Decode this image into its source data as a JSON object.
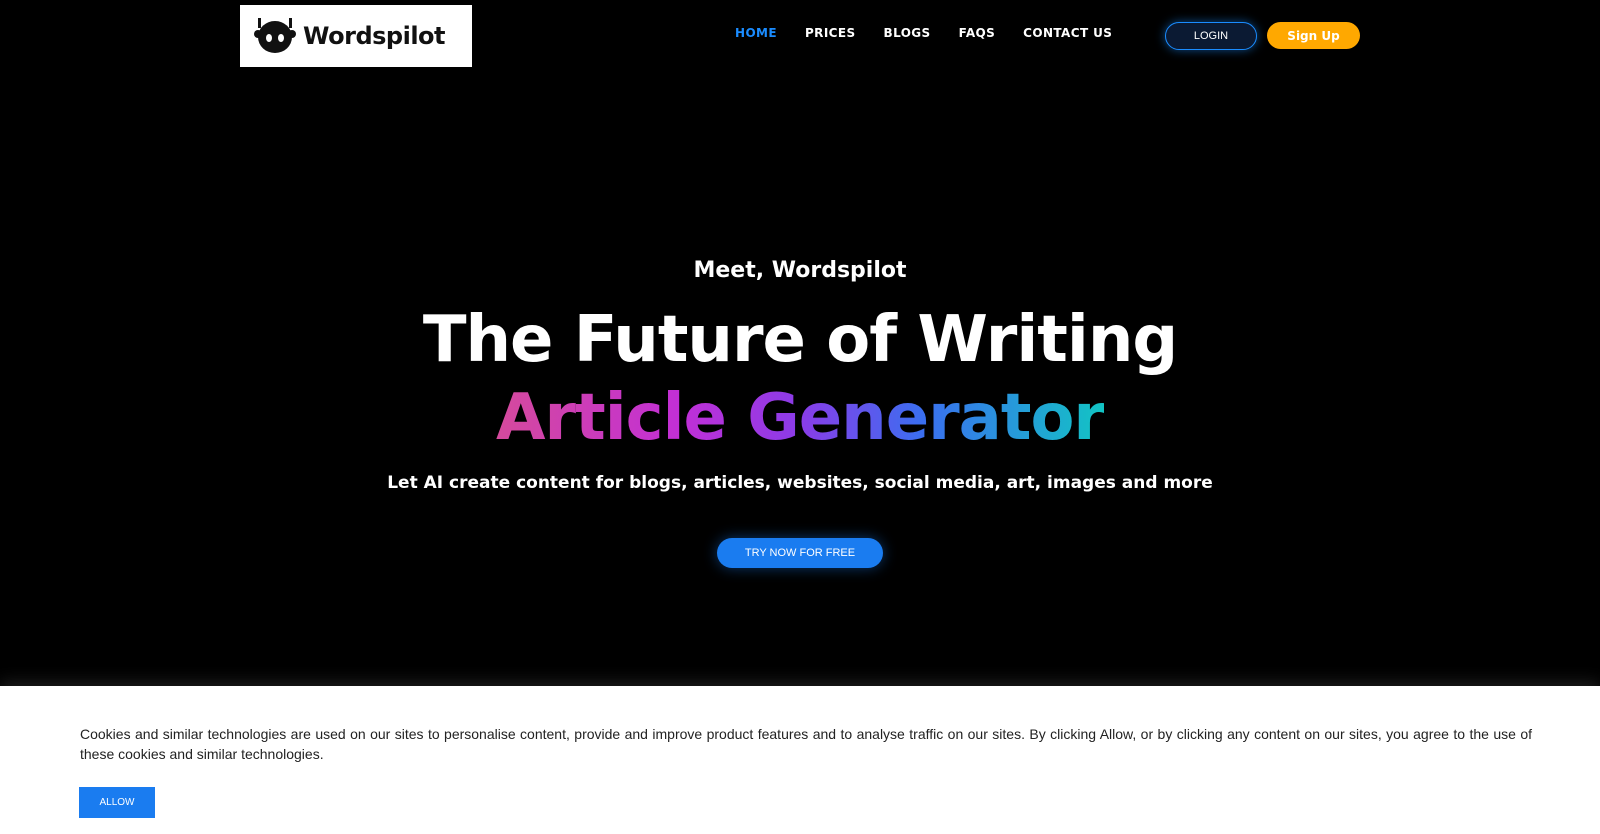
{
  "colors": {
    "accent": "#1a8cff",
    "signup": "#ffa800",
    "cta": "#1a7cf0",
    "background": "#000000"
  },
  "header": {
    "logo": {
      "text": "Wordspilot",
      "icon": "robot-head-icon"
    },
    "nav": [
      {
        "label": "HOME",
        "active": true
      },
      {
        "label": "PRICES",
        "active": false
      },
      {
        "label": "BLOGS",
        "active": false
      },
      {
        "label": "FAQS",
        "active": false
      },
      {
        "label": "CONTACT US",
        "active": false
      }
    ],
    "login_label": "LOGIN",
    "signup_label": "Sign Up"
  },
  "hero": {
    "eyebrow": "Meet, Wordspilot",
    "title": "The Future of Writing",
    "gradient_title": "Article Generator",
    "subtitle": "Let AI create content for blogs, articles, websites, social media, art, images and more",
    "cta_label": "TRY NOW FOR FREE"
  },
  "cookie_banner": {
    "text": "Cookies and similar technologies are used on our sites to personalise content, provide and improve product features and to analyse traffic on our sites. By clicking Allow, or by clicking any content on our sites, you agree to the use of these cookies and similar technologies.",
    "allow_label": "ALLOW"
  }
}
